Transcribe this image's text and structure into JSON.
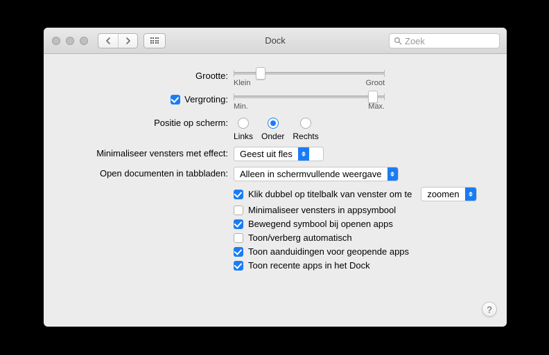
{
  "window": {
    "title": "Dock"
  },
  "toolbar": {
    "search_placeholder": "Zoek"
  },
  "sliders": {
    "size": {
      "label": "Grootte:",
      "min_label": "Klein",
      "max_label": "Groot",
      "value_pct": 18
    },
    "magnification": {
      "label": "Vergroting:",
      "checked": true,
      "min_label": "Min.",
      "max_label": "Max.",
      "value_pct": 92
    }
  },
  "position": {
    "label": "Positie op scherm:",
    "options": [
      {
        "label": "Links",
        "checked": false
      },
      {
        "label": "Onder",
        "checked": true
      },
      {
        "label": "Rechts",
        "checked": false
      }
    ]
  },
  "minimize_effect": {
    "label": "Minimaliseer vensters met effect:",
    "value": "Geest uit fles"
  },
  "open_tabs": {
    "label": "Open documenten in tabbladen:",
    "value": "Alleen in schermvullende weergave"
  },
  "checks": {
    "dblclick": {
      "checked": true,
      "label": "Klik dubbel op titelbalk van venster om te",
      "action": "zoomen"
    },
    "min_into_icon": {
      "checked": false,
      "label": "Minimaliseer vensters in appsymbool"
    },
    "animate": {
      "checked": true,
      "label": "Bewegend symbool bij openen apps"
    },
    "autohide": {
      "checked": false,
      "label": "Toon/verberg automatisch"
    },
    "indicators": {
      "checked": true,
      "label": "Toon aanduidingen voor geopende apps"
    },
    "recents": {
      "checked": true,
      "label": "Toon recente apps in het Dock"
    }
  },
  "help": "?"
}
